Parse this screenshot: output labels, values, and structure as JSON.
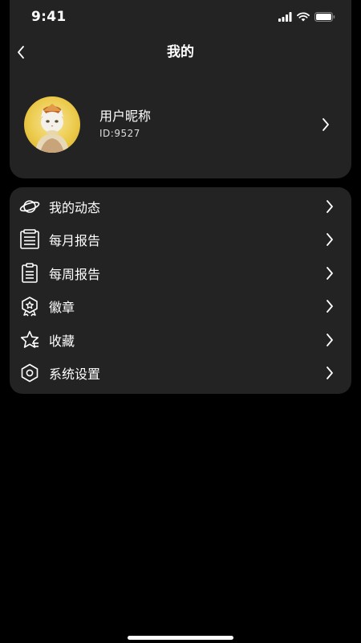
{
  "status_bar": {
    "time": "9:41"
  },
  "nav": {
    "title": "我的"
  },
  "profile": {
    "nickname": "用户昵称",
    "id_text": "ID:9527"
  },
  "menu": [
    {
      "label": "我的动态",
      "icon": "planet-icon"
    },
    {
      "label": "每月报告",
      "icon": "monthly-report-icon"
    },
    {
      "label": "每周报告",
      "icon": "weekly-report-icon"
    },
    {
      "label": "徽章",
      "icon": "badge-icon"
    },
    {
      "label": "收藏",
      "icon": "favorite-star-icon"
    },
    {
      "label": "系统设置",
      "icon": "settings-hexagon-icon"
    }
  ],
  "colors": {
    "background": "#000000",
    "card": "#232323",
    "text": "#ffffff"
  }
}
